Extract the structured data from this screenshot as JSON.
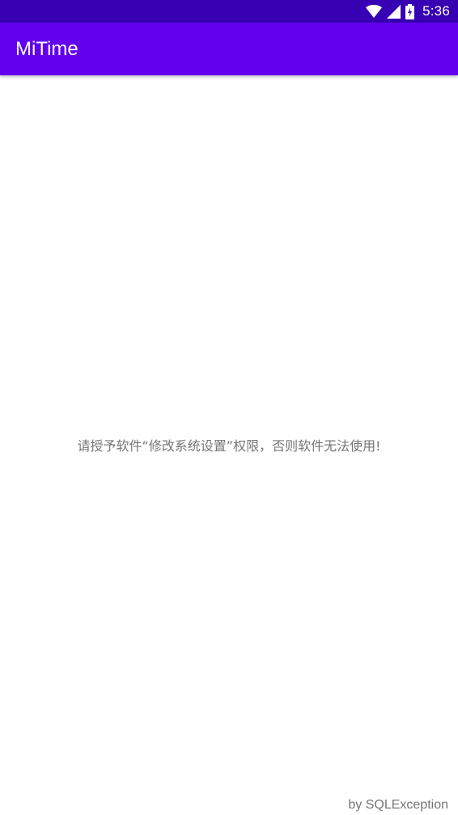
{
  "status_bar": {
    "time": "5:36",
    "icons": [
      "wifi-icon",
      "cellular-signal-icon",
      "battery-charging-icon"
    ]
  },
  "app_bar": {
    "title": "MiTime"
  },
  "main": {
    "message": "请授予软件“修改系统设置”权限，否则软件无法使用!"
  },
  "footer": {
    "credit": "by SQLException"
  },
  "colors": {
    "status_bar": "#3700b3",
    "app_bar": "#6200ee",
    "text_secondary": "#757575",
    "background": "#ffffff"
  }
}
